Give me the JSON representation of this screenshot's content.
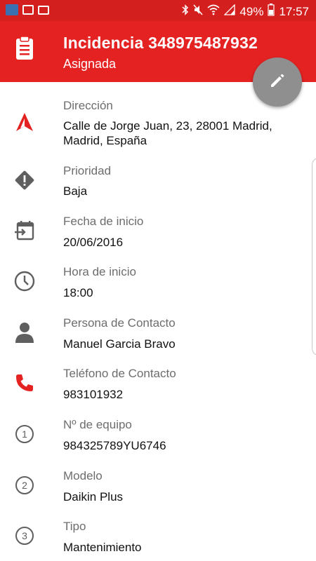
{
  "status_bar": {
    "battery": "49%",
    "time": "17:57"
  },
  "header": {
    "title": "Incidencia 348975487932",
    "subtitle": "Asignada"
  },
  "details": [
    {
      "label": "Dirección",
      "value": "Calle de Jorge Juan, 23, 28001 Madrid, Madrid, España",
      "icon": "navigation-arrow-icon"
    },
    {
      "label": "Prioridad",
      "value": "Baja",
      "icon": "priority-warning-icon"
    },
    {
      "label": "Fecha de inicio",
      "value": "20/06/2016",
      "icon": "calendar-import-icon"
    },
    {
      "label": "Hora de inicio",
      "value": "18:00",
      "icon": "clock-icon"
    },
    {
      "label": "Persona de Contacto",
      "value": "Manuel Garcia Bravo",
      "icon": "person-icon"
    },
    {
      "label": "Teléfono de Contacto",
      "value": "983101932",
      "icon": "phone-icon"
    },
    {
      "label": "Nº de equipo",
      "value": "984325789YU6746",
      "icon": "number-1-icon",
      "icon_text": "1"
    },
    {
      "label": "Modelo",
      "value": "Daikin Plus",
      "icon": "number-2-icon",
      "icon_text": "2"
    },
    {
      "label": "Tipo",
      "value": "Mantenimiento",
      "icon": "number-3-icon",
      "icon_text": "3"
    }
  ],
  "colors": {
    "status_bar": "#d41f1f",
    "header": "#e52222",
    "accent_red": "#e52222",
    "icon_gray": "#5f5f5f",
    "fab": "#8f8f8f"
  }
}
